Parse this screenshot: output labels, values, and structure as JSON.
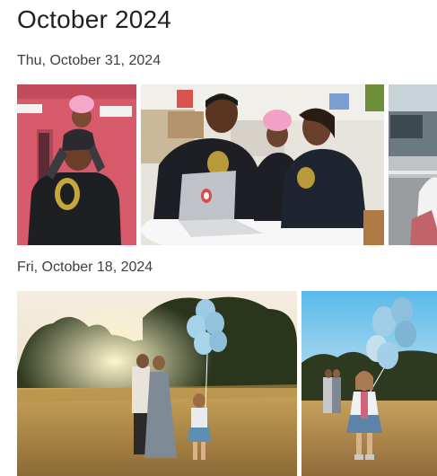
{
  "page": {
    "title": "October 2024"
  },
  "groups": [
    {
      "date_label": "Thu, October 31, 2024",
      "photos": [
        {
          "name": "photo-father-daughter-on-shoulders",
          "alt": "Father carrying daughter on shoulders"
        },
        {
          "name": "photo-family-at-laptop",
          "alt": "Family gathered around a laptop"
        },
        {
          "name": "photo-partial-outdoor",
          "alt": "Partial outdoor photo"
        }
      ]
    },
    {
      "date_label": "Fri, October 18, 2024",
      "photos": [
        {
          "name": "photo-family-field-balloons",
          "alt": "Family in a field with balloons at sunset"
        },
        {
          "name": "photo-girl-with-balloons",
          "alt": "Girl holding blue balloons in a field"
        }
      ]
    }
  ],
  "colors": {
    "text_primary": "#202124",
    "text_secondary": "#3c4043",
    "background": "#ffffff",
    "balloon_blue": "#9ccbe3"
  }
}
